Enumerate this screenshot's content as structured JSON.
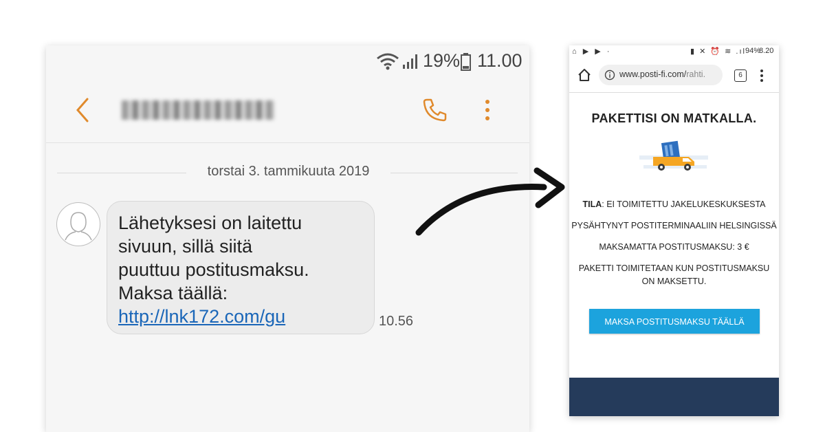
{
  "sms": {
    "status_bar": {
      "battery_percent": "19%",
      "time": "11.00"
    },
    "date_separator": "torstai 3. tammikuuta 2019",
    "message": {
      "lines": [
        "Lähetyksesi on laitettu",
        "sivuun, sillä siitä",
        "puuttuu postitusmaksu.",
        "Maksa täällä:"
      ],
      "link": "http://lnk172.com/gu",
      "time": "10.56"
    }
  },
  "browser": {
    "status_bar": {
      "left_icons": "⌂ ▶ ▶ ·",
      "right_icons": "▮ ✕ ⏰ ≋ .ıl",
      "battery": "94%",
      "time": "8.20"
    },
    "url_host": "www.posti-fi.com/",
    "url_path": "rahti.",
    "tab_count": "6",
    "page": {
      "title": "PAKETTISI ON MATKALLA.",
      "status_label": "TILA",
      "status_value": ": EI TOIMITETTU JAKELUKESKUKSESTA",
      "line2": "PYSÄHTYNYT POSTITERMINAALIIN HELSINGISSÄ",
      "line3": "MAKSAMATTA POSTITUSMAKSU: 3 €",
      "line4a": "PAKETTI TOIMITETAAN KUN POSTITUSMAKSU",
      "line4b": "ON MAKSETTU.",
      "button": "MAKSA POSTITUSMAKSU TÄÄLLÄ"
    }
  },
  "colors": {
    "accent_orange": "#e08a2c",
    "link_blue": "#1a66b8",
    "button_blue": "#1ca3dd",
    "footer_navy": "#253b5b"
  }
}
